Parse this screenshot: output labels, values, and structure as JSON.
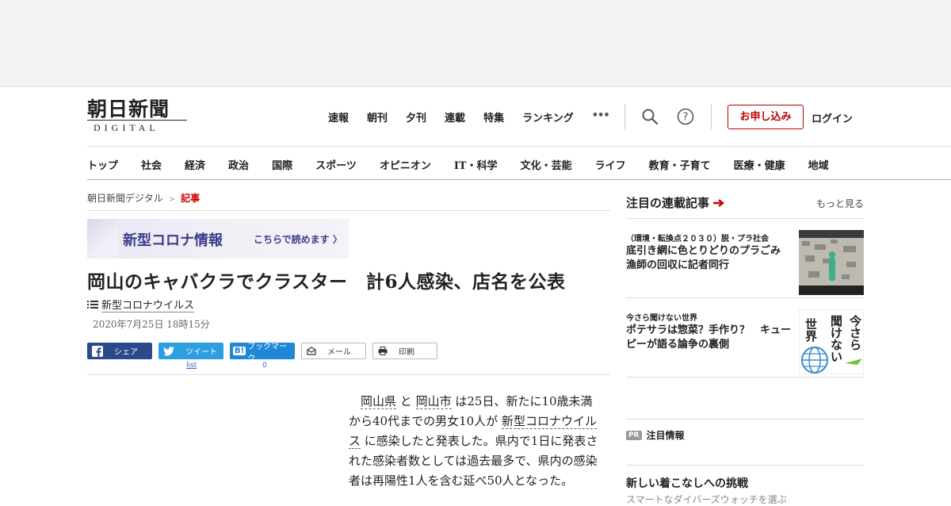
{
  "header": {
    "logo_main": "朝日新聞",
    "logo_sub": "DIGITAL",
    "topnav": [
      "速報",
      "朝刊",
      "夕刊",
      "連載",
      "特集",
      "ランキング",
      "•••"
    ],
    "apply_label": "お申し込み",
    "login_label": "ログイン"
  },
  "catnav": [
    "トップ",
    "社会",
    "経済",
    "政治",
    "国際",
    "スポーツ",
    "オピニオン",
    "IT・科学",
    "文化・芸能",
    "ライフ",
    "教育・子育て",
    "医療・健康",
    "地域"
  ],
  "breadcrumb": {
    "home": "朝日新聞デジタル",
    "sep": ">",
    "current": "記事"
  },
  "banner": {
    "title": "新型コロナ情報",
    "link": "こちらで読めます"
  },
  "article": {
    "title": "岡山のキャバクラでクラスター　計6人感染、店名を公表",
    "tag": "新型コロナウイルス",
    "date": "2020年7月25日 18時15分",
    "body_1": "岡山県",
    "body_2": " と ",
    "body_3": "岡山市",
    "body_4": " は25日、新たに10歳未満から40代までの男女10人が ",
    "body_5": "新型コロナウイルス",
    "body_6": " に感染したと発表した。県内で1日に発表された感染者数としては過去最多で、県内の感染者は再陽性1人を含む延べ50人となった。"
  },
  "share": {
    "facebook": "シェア",
    "twitter": "ツイート",
    "hatena": "ブックマーク",
    "mail": "メール",
    "print": "印刷",
    "twitter_count": "list",
    "hatena_count": "0"
  },
  "sidebar": {
    "heading": "注目の連載記事",
    "more": "もっと見る",
    "cards": [
      {
        "kicker": "（環境・転換点２０３０）脱・プラ社会",
        "title": "底引き網に色とりどりのプラごみ　漁師の回収に記者同行"
      },
      {
        "kicker": "今さら聞けない世界",
        "title": "ポテサラは惣菜？手作り？　キューピーが語る論争の裏側",
        "thumb_text_1": "今さら",
        "thumb_text_2": "聞けない",
        "thumb_text_3": "世界"
      }
    ],
    "pr_badge": "PR",
    "pr_label": "注目情報",
    "next_title": "新しい着こなしへの挑戦",
    "next_sub": "スマートなダイバーズウォッチを選ぶ"
  }
}
